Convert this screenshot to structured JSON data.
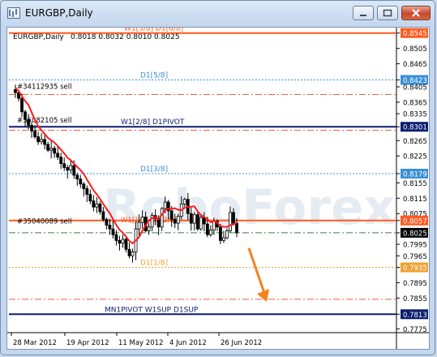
{
  "window": {
    "title": "EURGBP,Daily",
    "buttons": [
      "minimize",
      "restore",
      "close"
    ]
  },
  "chart_header": {
    "symbol": "EURGBP,Daily",
    "ohlc": "0.8018 0.8032 0.8010 0.8025"
  },
  "watermark": "RoboForex",
  "chart_data": {
    "type": "candlestick",
    "symbol": "EURGBP",
    "timeframe": "Daily",
    "ylim": [
      0.7765,
      0.8555
    ],
    "y_ticks": [
      0.8545,
      0.8505,
      0.8465,
      0.8423,
      0.8405,
      0.8365,
      0.8335,
      0.8301,
      0.8265,
      0.8225,
      0.8179,
      0.8155,
      0.8115,
      0.8075,
      0.8057,
      0.8025,
      0.7995,
      0.7965,
      0.7935,
      0.7895,
      0.7855,
      0.7813,
      0.7775
    ],
    "x_tick_labels": [
      "28 Mar 2012",
      "19 Apr 2012",
      "11 May 2012",
      "4 Jun 2012",
      "26 Jun 2012"
    ],
    "current_price": 0.8025,
    "levels": [
      {
        "label": "W1[3/8] D1[6/8]",
        "value": 0.8545,
        "color": "#ff5a1f",
        "style": "solid"
      },
      {
        "label": "D1[5/8]",
        "value": 0.8423,
        "color": "#3a8fd8",
        "style": "dotted"
      },
      {
        "label": "W1[2/8] D1PIVOT",
        "value": 0.8301,
        "color": "#0b1e6e",
        "style": "solid"
      },
      {
        "label": "D1[3/8]",
        "value": 0.8179,
        "color": "#3a8fd8",
        "style": "dotted"
      },
      {
        "label": "",
        "value": 0.8057,
        "color": "#ff5a1f",
        "style": "solid"
      },
      {
        "label": "D1[1/8]",
        "value": 0.7935,
        "color": "#f0a030",
        "style": "dotted"
      },
      {
        "label": "MN1PIVOT W1SUP D1SUP",
        "value": 0.7813,
        "color": "#0b1e6e",
        "style": "solid"
      }
    ],
    "dashdot_levels": [
      0.8385,
      0.8292,
      0.8025,
      0.7852
    ],
    "order_labels": [
      {
        "text": "#34112935 sell",
        "value": 0.8395
      },
      {
        "text": "#35082105 sell",
        "value": 0.8308
      },
      {
        "text": "#35040089 sell",
        "value": 0.8045
      },
      {
        "text": "W1[1/8] D1[2/8]",
        "value": 0.8048
      }
    ],
    "closes": [
      0.839,
      0.8375,
      0.834,
      0.832,
      0.8305,
      0.829,
      0.8275,
      0.8262,
      0.8268,
      0.8255,
      0.824,
      0.8245,
      0.8232,
      0.8222,
      0.8205,
      0.8195,
      0.8188,
      0.82,
      0.8175,
      0.8165,
      0.8152,
      0.814,
      0.8125,
      0.8108,
      0.8092,
      0.81,
      0.808,
      0.806,
      0.8045,
      0.8035,
      0.802,
      0.8005,
      0.7998,
      0.8008,
      0.7982,
      0.7965,
      0.7975,
      0.8035,
      0.8052,
      0.8066,
      0.803,
      0.804,
      0.807,
      0.8062,
      0.804,
      0.8088,
      0.8105,
      0.8082,
      0.806,
      0.805,
      0.8068,
      0.81,
      0.8112,
      0.8075,
      0.805,
      0.8072,
      0.8035,
      0.8065,
      0.8048,
      0.802,
      0.8032,
      0.8055,
      0.804,
      0.8005,
      0.8012,
      0.803,
      0.8078,
      0.805,
      0.8025
    ],
    "ma_line": {
      "color": "#ff1a1a"
    },
    "forecast_arrow": {
      "from": 0.7985,
      "to": 0.7845,
      "color": "#f58220"
    }
  }
}
